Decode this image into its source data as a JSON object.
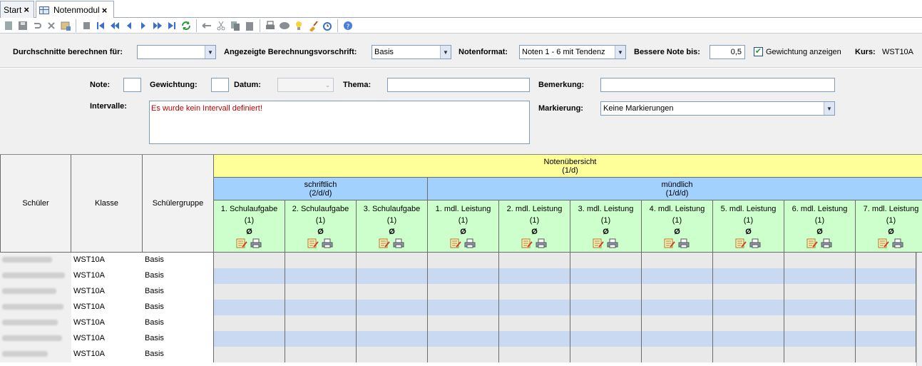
{
  "tabs": [
    {
      "label": "Start",
      "close": "×",
      "active": false
    },
    {
      "label": "Notenmodul",
      "close": "×",
      "active": true
    }
  ],
  "toolbar_icons": [
    "new-icon",
    "save-icon",
    "undo-icon",
    "delete-icon",
    "properties-icon",
    "copy-record-icon",
    "first-icon",
    "prev-page-icon",
    "prev-icon",
    "next-icon",
    "next-page-icon",
    "last-icon",
    "refresh-icon",
    "back-icon",
    "cut-icon",
    "copy-icon",
    "paste-icon",
    "print-icon",
    "preview-icon",
    "bulb-icon",
    "brush-icon",
    "alarm-icon",
    "help-icon"
  ],
  "filterbar": {
    "avg_label": "Durchschnitte berechnen für:",
    "avg_value": "",
    "rule_label": "Angezeigte Berechnungsvorschrift:",
    "rule_value": "Basis",
    "format_label": "Notenformat:",
    "format_value": "Noten 1 - 6 mit Tendenz",
    "better_label": "Bessere Note bis:",
    "better_value": "0,5",
    "weight_checkbox_label": "Gewichtung anzeigen",
    "weight_checked": true,
    "course_label": "Kurs:",
    "course_value": "WST10A"
  },
  "detail": {
    "note_label": "Note:",
    "weight_label": "Gewichtung:",
    "date_label": "Datum:",
    "topic_label": "Thema:",
    "remark_label": "Bemerkung:",
    "interval_label": "Intervalle:",
    "interval_message": "Es wurde kein Intervall definiert!",
    "marking_label": "Markierung:",
    "marking_value": "Keine Markierungen"
  },
  "grid": {
    "col_headers": {
      "student": "Schüler",
      "class": "Klasse",
      "group": "Schülergruppe"
    },
    "overview": {
      "title": "Notenübersicht",
      "sub": "(1/d)"
    },
    "written": {
      "title": "schriftlich",
      "sub": "(2/d/d)"
    },
    "oral": {
      "title": "mündlich",
      "sub": "(1/d/d)"
    },
    "exams": [
      {
        "title": "1. Schulaufgabe",
        "weight": "(1)",
        "avg": "Ø"
      },
      {
        "title": "2. Schulaufgabe",
        "weight": "(1)",
        "avg": "Ø"
      },
      {
        "title": "3. Schulaufgabe",
        "weight": "(1)",
        "avg": "Ø"
      },
      {
        "title": "1. mdl. Leistung",
        "weight": "(1)",
        "avg": "Ø"
      },
      {
        "title": "2. mdl. Leistung",
        "weight": "(1)",
        "avg": "Ø"
      },
      {
        "title": "3. mdl. Leistung",
        "weight": "(1)",
        "avg": "Ø"
      },
      {
        "title": "4. mdl. Leistung",
        "weight": "(1)",
        "avg": "Ø"
      },
      {
        "title": "5. mdl. Leistung",
        "weight": "(1)",
        "avg": "Ø"
      },
      {
        "title": "6. mdl. Leistung",
        "weight": "(1)",
        "avg": "Ø"
      },
      {
        "title": "7. mdl. Leistung",
        "weight": "(1)",
        "avg": "Ø"
      }
    ],
    "rows": [
      {
        "class": "WST10A",
        "group": "Basis"
      },
      {
        "class": "WST10A",
        "group": "Basis"
      },
      {
        "class": "WST10A",
        "group": "Basis"
      },
      {
        "class": "WST10A",
        "group": "Basis"
      },
      {
        "class": "WST10A",
        "group": "Basis"
      },
      {
        "class": "WST10A",
        "group": "Basis"
      },
      {
        "class": "WST10A",
        "group": "Basis"
      }
    ]
  },
  "colors": {
    "header_yellow": "#ffff99",
    "header_blue": "#a3d1fd",
    "header_green": "#ccffcc",
    "row_stripe": "#c9d9f1",
    "error_red": "#c00000"
  }
}
